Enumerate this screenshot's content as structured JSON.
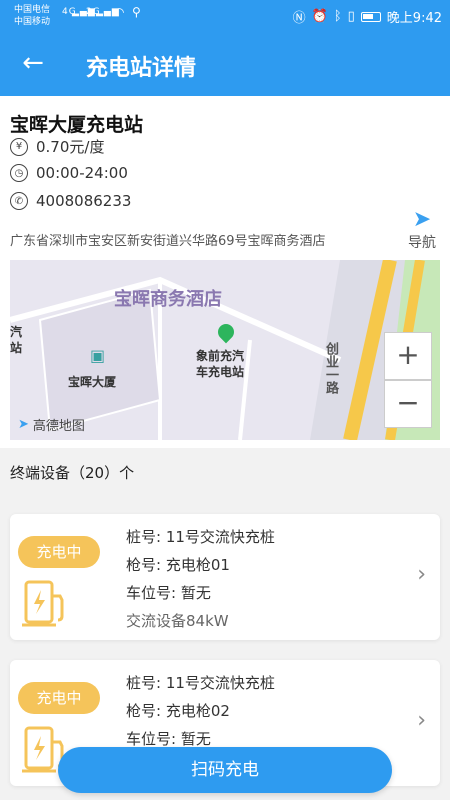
{
  "status_bar": {
    "carrier1": "中国电信",
    "carrier2": "中国移动",
    "net1": "4G",
    "net2": "2G",
    "time": "晚上9:42"
  },
  "app_bar": {
    "title": "充电站详情"
  },
  "station": {
    "name": "宝晖大厦充电站",
    "price": "0.70元/度",
    "hours": "00:00-24:00",
    "phone": "4008086233",
    "address": "广东省深圳市宝安区新安街道兴华路69号宝晖商务酒店",
    "nav_label": "导航"
  },
  "map": {
    "hotel_label": "宝晖商务酒店",
    "building_label": "宝晖大厦",
    "pin_label_line1": "象前充汽",
    "pin_label_line2": "车充电站",
    "left_label_line1": "汽",
    "left_label_line2": "站",
    "road_label": "创业一路",
    "zoom_in": "+",
    "zoom_out": "−",
    "logo": "高德地图"
  },
  "devices": {
    "title": "终端设备（20）个",
    "list": [
      {
        "status": "充电中",
        "pile": "桩号:  11号交流快充桩",
        "gun": "枪号:  充电枪01",
        "spot": "车位号:  暂无",
        "spec": "交流设备84kW"
      },
      {
        "status": "充电中",
        "pile": "桩号:  11号交流快充桩",
        "gun": "枪号:  充电枪02",
        "spot": "车位号:  暂无"
      }
    ]
  },
  "scan_button": "扫码充电",
  "colors": {
    "primary": "#2e9bf0",
    "badge": "#f5c45a",
    "map_bg": "#e8e6f0",
    "road_yellow": "#f6c84a",
    "green_area": "#c7e8b8"
  }
}
